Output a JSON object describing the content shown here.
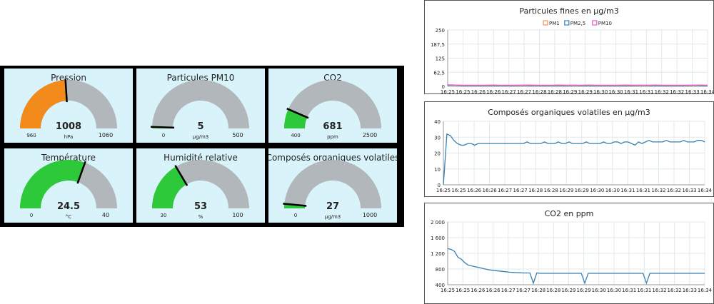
{
  "colors": {
    "card_bg": "#d9f3fb",
    "gauge_track": "#b2b7bb",
    "gauge_orange": "#f28a1c",
    "gauge_green": "#2ec93a",
    "needle": "#000000",
    "pm1": "#f0935a",
    "pm25": "#3a7fb0",
    "pm10": "#e65fd0",
    "line": "#3a7fb0",
    "grid": "#dfe9ee"
  },
  "gauges": [
    {
      "title": "Pression",
      "value": "1008",
      "unit": "hPa",
      "min": "960",
      "max": "1060",
      "fill": 0.48,
      "color": "orange",
      "needle": 0.48
    },
    {
      "title": "Particules PM10",
      "value": "5",
      "unit": "µg/m3",
      "min": "0",
      "max": "500",
      "fill": 0.01,
      "color": "green",
      "needle": 0.01
    },
    {
      "title": "CO2",
      "value": "681",
      "unit": "ppm",
      "min": "400",
      "max": "2500",
      "fill": 0.13,
      "color": "green",
      "needle": 0.13
    },
    {
      "title": "Température",
      "value": "24.5",
      "unit": "°C",
      "min": "0",
      "max": "40",
      "fill": 0.61,
      "color": "green",
      "needle": 0.61
    },
    {
      "title": "Humidité relative",
      "value": "53",
      "unit": "%",
      "min": "30",
      "max": "100",
      "fill": 0.33,
      "color": "green",
      "needle": 0.33
    },
    {
      "title": "Composés organiques volatiles",
      "value": "27",
      "unit": "µg/m3",
      "min": "0",
      "max": "1000",
      "fill": 0.03,
      "color": "green",
      "needle": 0.03
    }
  ],
  "chart_data": [
    {
      "type": "line",
      "title": "Particules fines en µg/m3",
      "x_ticks": [
        "16:25",
        "16:25",
        "16:26",
        "16:26",
        "16:27",
        "16:27",
        "16:28",
        "16:28",
        "16:29",
        "16:29",
        "16:30",
        "16:30",
        "16:31",
        "16:31",
        "16:32",
        "16:32",
        "16:33",
        "16:34"
      ],
      "y_ticks": [
        "0",
        "62,5",
        "125",
        "187,5",
        "250"
      ],
      "ylim": [
        0,
        250
      ],
      "legend": "top-center",
      "grid": true,
      "series": [
        {
          "name": "PM1",
          "color_key": "pm1",
          "values": [
            6,
            5,
            4,
            4,
            4,
            4,
            5,
            4,
            4,
            4,
            4,
            5,
            4,
            4,
            4,
            5,
            4,
            4,
            4,
            5,
            4,
            4,
            4,
            4,
            5,
            4,
            4,
            4,
            5,
            4,
            4,
            4,
            4,
            4,
            5,
            4
          ]
        },
        {
          "name": "PM2,5",
          "color_key": "pm25",
          "values": [
            5,
            5,
            4,
            4,
            4,
            4,
            4,
            4,
            4,
            4,
            5,
            4,
            4,
            4,
            4,
            4,
            4,
            5,
            4,
            4,
            4,
            4,
            4,
            4,
            4,
            4,
            5,
            4,
            4,
            4,
            4,
            4,
            4,
            5,
            4,
            4
          ]
        },
        {
          "name": "PM10",
          "color_key": "pm10",
          "values": [
            7,
            6,
            5,
            5,
            5,
            5,
            6,
            5,
            5,
            5,
            5,
            6,
            5,
            5,
            5,
            6,
            5,
            5,
            5,
            6,
            5,
            5,
            5,
            5,
            6,
            5,
            5,
            5,
            6,
            5,
            5,
            5,
            5,
            5,
            6,
            5
          ]
        }
      ]
    },
    {
      "type": "line",
      "title": "Composés organiques volatiles en µg/m3",
      "x_ticks": [
        "16:25",
        "16:25",
        "16:26",
        "16:26",
        "16:27",
        "16:27",
        "16:28",
        "16:28",
        "16:29",
        "16:29",
        "16:30",
        "16:30",
        "16:31",
        "16:31",
        "16:32",
        "16:32",
        "16:33",
        "16:34"
      ],
      "y_ticks": [
        "0",
        "10",
        "20",
        "30",
        "40"
      ],
      "ylim": [
        0,
        40
      ],
      "legend": "none",
      "grid": true,
      "series": [
        {
          "name": "",
          "color_key": "line",
          "values": [
            0,
            32,
            31,
            28,
            26,
            25,
            25,
            26,
            26,
            25,
            26,
            26,
            26,
            26,
            26,
            26,
            26,
            26,
            26,
            26,
            26,
            26,
            26,
            26,
            27,
            26,
            26,
            26,
            26,
            27,
            26,
            26,
            26,
            27,
            26,
            26,
            27,
            26,
            26,
            26,
            26,
            27,
            26,
            26,
            26,
            26,
            27,
            26,
            26,
            27,
            27,
            26,
            27,
            27,
            26,
            25,
            27,
            26,
            27,
            28,
            27,
            27,
            27,
            27,
            28,
            27,
            27,
            27,
            27,
            28,
            27,
            27,
            27,
            28,
            28,
            27
          ]
        }
      ]
    },
    {
      "type": "line",
      "title": "CO2 en ppm",
      "x_ticks": [
        "16:25",
        "16:25",
        "16:26",
        "16:26",
        "16:27",
        "16:27",
        "16:28",
        "16:28",
        "16:29",
        "16:29",
        "16:30",
        "16:30",
        "16:31",
        "16:31",
        "16:32",
        "16:32",
        "16:33",
        "16:34"
      ],
      "y_ticks": [
        "400",
        "800",
        "1 200",
        "1 600",
        "2 000"
      ],
      "ylim": [
        400,
        2000
      ],
      "legend": "none",
      "grid": true,
      "series": [
        {
          "name": "",
          "color_key": "line",
          "values": [
            1320,
            1300,
            1250,
            1100,
            1050,
            960,
            900,
            880,
            860,
            840,
            820,
            800,
            780,
            770,
            760,
            750,
            740,
            730,
            720,
            715,
            710,
            705,
            700,
            700,
            700,
            440,
            700,
            690,
            690,
            690,
            690,
            690,
            690,
            690,
            690,
            690,
            690,
            690,
            690,
            690,
            440,
            690,
            690,
            690,
            690,
            690,
            690,
            690,
            690,
            690,
            690,
            690,
            690,
            690,
            690,
            690,
            690,
            690,
            440,
            690,
            690,
            690,
            690,
            690,
            690,
            690,
            690,
            690,
            690,
            690,
            690,
            690,
            690,
            690,
            690,
            690
          ]
        }
      ]
    }
  ]
}
